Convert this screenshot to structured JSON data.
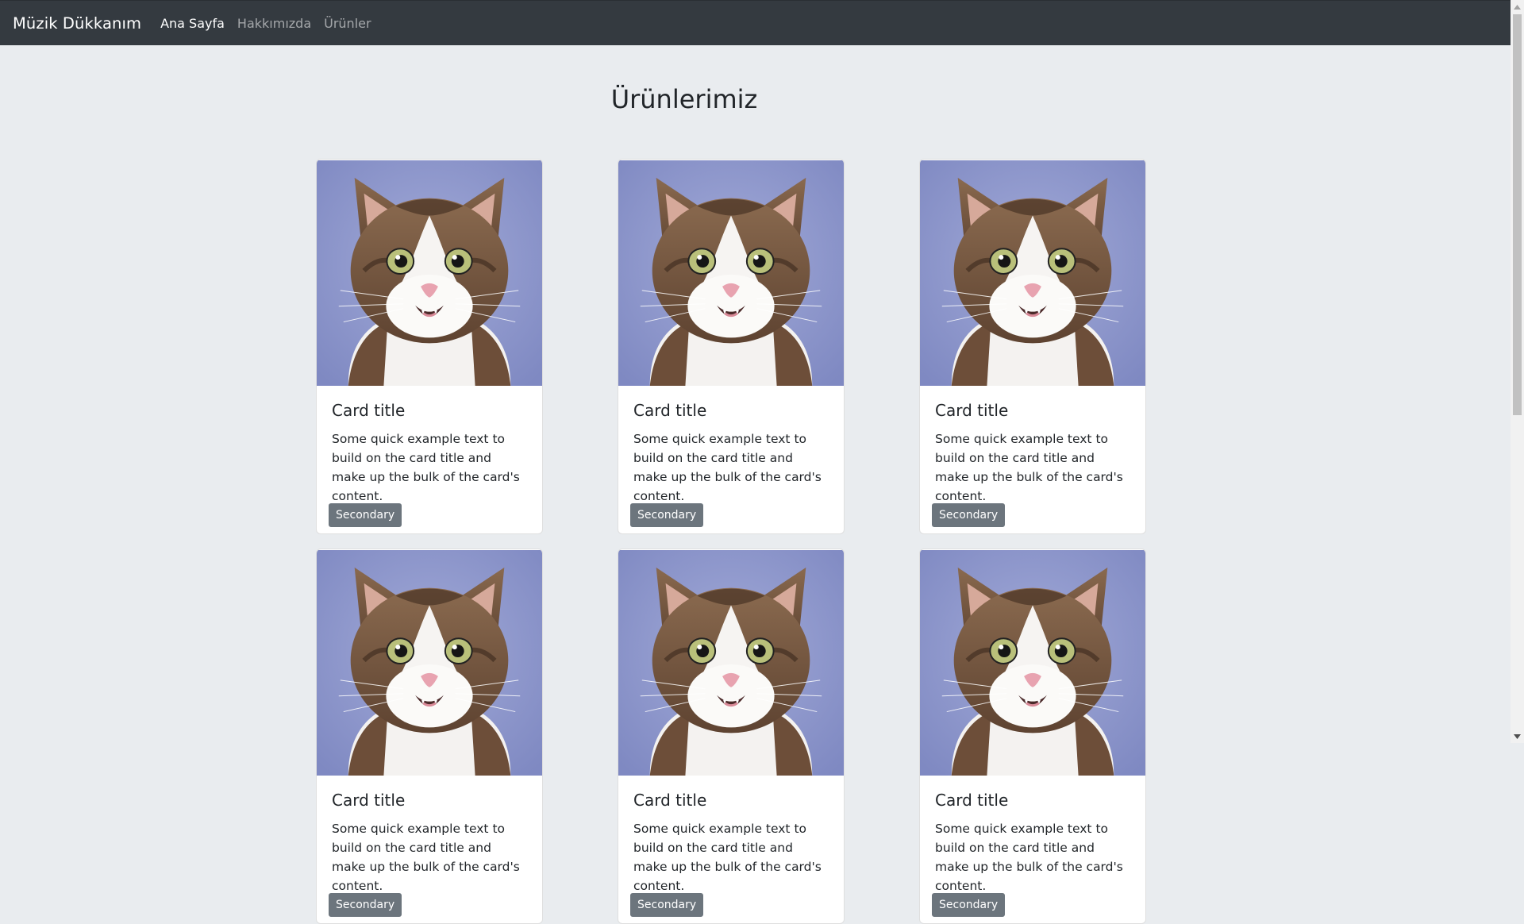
{
  "navbar": {
    "brand": "Müzik Dükkanım",
    "links": [
      {
        "label": "Ana Sayfa",
        "active": true
      },
      {
        "label": "Hakkımızda",
        "active": false
      },
      {
        "label": "Ürünler",
        "active": false
      }
    ]
  },
  "page": {
    "title": "Ürünlerimiz"
  },
  "cards": [
    {
      "title": "Card title",
      "text": "Some quick example text to build on the card title and make up the bulk of the card's content.",
      "button": "Secondary"
    },
    {
      "title": "Card title",
      "text": "Some quick example text to build on the card title and make up the bulk of the card's content.",
      "button": "Secondary"
    },
    {
      "title": "Card title",
      "text": "Some quick example text to build on the card title and make up the bulk of the card's content.",
      "button": "Secondary"
    },
    {
      "title": "Card title",
      "text": "Some quick example text to build on the card title and make up the bulk of the card's content.",
      "button": "Secondary"
    },
    {
      "title": "Card title",
      "text": "Some quick example text to build on the card title and make up the bulk of the card's content.",
      "button": "Secondary"
    },
    {
      "title": "Card title",
      "text": "Some quick example text to build on the card title and make up the bulk of the card's content.",
      "button": "Secondary"
    }
  ],
  "colors": {
    "navbar_bg": "#343a40",
    "page_bg": "#e9ecef",
    "button_bg": "#6c757d",
    "image_bg": "#8c96cc"
  },
  "icons": {
    "card_image": "cat-photo",
    "scroll_up": "arrow-up-icon",
    "scroll_down": "arrow-down-icon"
  }
}
